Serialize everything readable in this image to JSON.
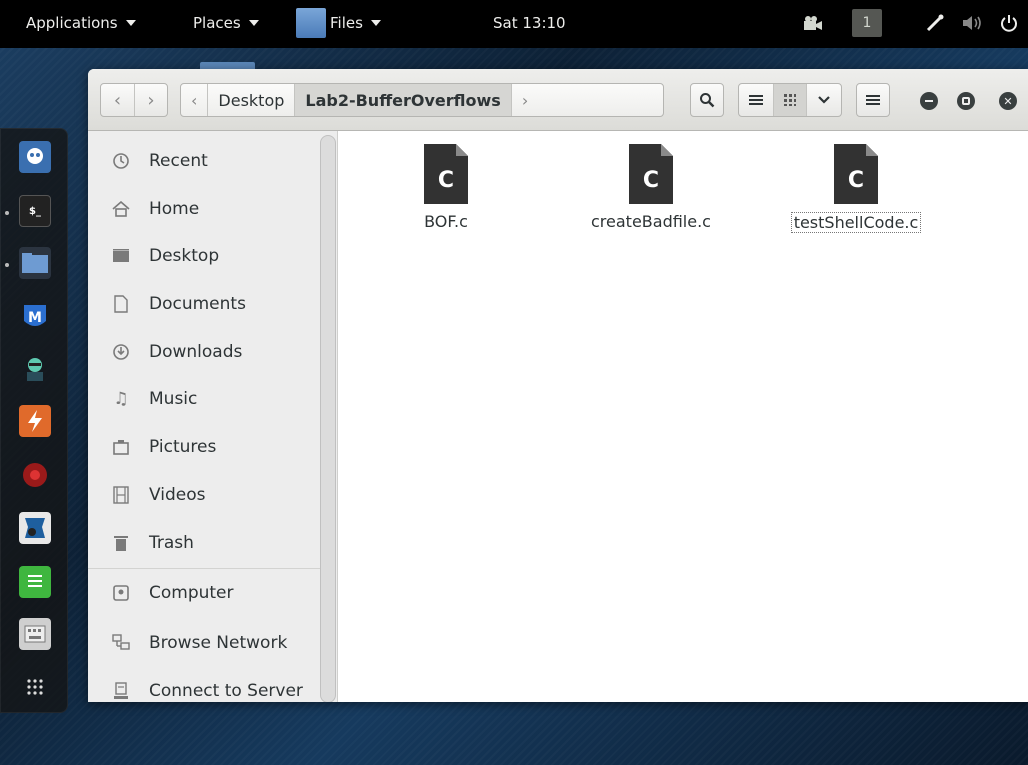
{
  "topbar": {
    "applications": "Applications",
    "places": "Places",
    "files": "Files",
    "clock": "Sat 13:10",
    "workspace": "1"
  },
  "window": {
    "path": [
      "Desktop",
      "Lab2-BufferOverflows"
    ]
  },
  "sidebar": {
    "items": [
      {
        "label": "Recent",
        "icon": "clock-icon"
      },
      {
        "label": "Home",
        "icon": "home-icon"
      },
      {
        "label": "Desktop",
        "icon": "desktop-icon"
      },
      {
        "label": "Documents",
        "icon": "document-icon"
      },
      {
        "label": "Downloads",
        "icon": "download-icon"
      },
      {
        "label": "Music",
        "icon": "music-icon"
      },
      {
        "label": "Pictures",
        "icon": "camera-icon"
      },
      {
        "label": "Videos",
        "icon": "film-icon"
      },
      {
        "label": "Trash",
        "icon": "trash-icon"
      }
    ],
    "network": [
      {
        "label": "Computer",
        "icon": "computer-icon"
      },
      {
        "label": "Browse Network",
        "icon": "network-icon"
      },
      {
        "label": "Connect to Server",
        "icon": "server-icon"
      }
    ]
  },
  "files": [
    {
      "name": "BOF.c",
      "glyph": "C"
    },
    {
      "name": "createBadfile.c",
      "glyph": "C"
    },
    {
      "name": "testShellCode.c",
      "glyph": "C",
      "selected": true
    }
  ]
}
